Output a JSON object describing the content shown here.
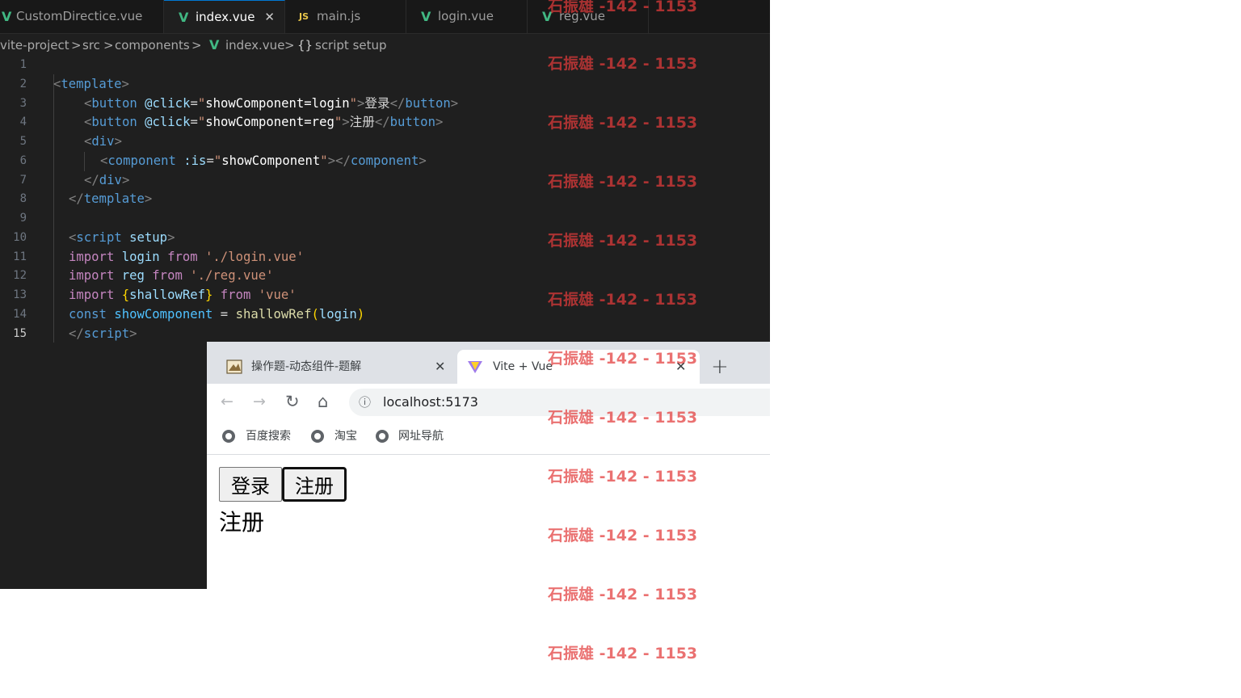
{
  "editor": {
    "tabs": [
      {
        "label": "CustomDirectice.vue",
        "icon": "vue-icon"
      },
      {
        "label": "index.vue",
        "icon": "vue-icon",
        "active": true
      },
      {
        "label": "main.js",
        "icon": "js-icon",
        "icon_text": "JS"
      },
      {
        "label": "login.vue",
        "icon": "vue-icon"
      },
      {
        "label": "reg.vue",
        "icon": "vue-icon"
      }
    ],
    "close_glyph": "✕",
    "breadcrumb": {
      "project": "vite-project",
      "sep": ">",
      "src": "src",
      "components": "components",
      "file": "index.vue",
      "symbol_icon": "{}",
      "symbol": "script setup"
    },
    "line_numbers": [
      "1",
      "2",
      "3",
      "4",
      "5",
      "6",
      "7",
      "8",
      "9",
      "10",
      "11",
      "12",
      "13",
      "14",
      "15"
    ],
    "current_line": "15",
    "code": {
      "l2": {
        "open": "<",
        "tag": "template",
        "close": ">"
      },
      "l3": {
        "open": "<",
        "tag": "button",
        "attr": "@click",
        "eq": "=",
        "q": "\"",
        "val": "showComponent=login",
        "gt": ">",
        "text": "登录",
        "etag_open": "</",
        "etag": "button",
        "etag_close": ">"
      },
      "l4": {
        "open": "<",
        "tag": "button",
        "attr": "@click",
        "eq": "=",
        "q": "\"",
        "val": "showComponent=reg",
        "gt": ">",
        "text": "注册",
        "etag_open": "</",
        "etag": "button",
        "etag_close": ">"
      },
      "l5": {
        "open": "<",
        "tag": "div",
        "close": ">"
      },
      "l6": {
        "open": "<",
        "tag": "component",
        "attr": ":is",
        "eq": "=",
        "q": "\"",
        "val": "showComponent",
        "gt": ">",
        "etag_open": "</",
        "etag": "component",
        "etag_close": ">"
      },
      "l7": {
        "open": "</",
        "tag": "div",
        "close": ">"
      },
      "l8": {
        "open": "</",
        "tag": "template",
        "close": ">"
      },
      "l10": {
        "open": "<",
        "tag": "script",
        "attr": "setup",
        "close": ">"
      },
      "l11": {
        "kw": "import",
        "name": "login",
        "from": "from",
        "str": "'./login.vue'"
      },
      "l12": {
        "kw": "import",
        "name": "reg",
        "from": "from",
        "str": "'./reg.vue'"
      },
      "l13": {
        "kw": "import",
        "lb": "{",
        "name": "shallowRef",
        "rb": "}",
        "from": "from",
        "str": "'vue'"
      },
      "l14": {
        "kw": "const",
        "name": "showComponent",
        "eq": "=",
        "fn": "shallowRef",
        "lp": "(",
        "arg": "login",
        "rp": ")"
      },
      "l15": {
        "open": "</",
        "tag": "script",
        "close": ">"
      }
    }
  },
  "browser": {
    "tabs": [
      {
        "title": "操作题-动态组件-题解",
        "icon": "article-favicon-icon"
      },
      {
        "title": "Vite + Vue",
        "icon": "vite-logo-icon",
        "active": true
      }
    ],
    "close_glyph": "✕",
    "new_tab_glyph": "+",
    "nav": {
      "back": "←",
      "forward": "→",
      "reload": "↻",
      "home": "⌂"
    },
    "address": {
      "info_icon": "ⓘ",
      "url": "localhost:5173"
    },
    "bookmarks": [
      "百度搜索",
      "淘宝",
      "网址导航"
    ],
    "page": {
      "buttons": [
        "登录",
        "注册"
      ],
      "component_text": "注册"
    }
  },
  "watermark": {
    "text": "石振雄 -142 - 1153",
    "color": "#e33b3b"
  }
}
